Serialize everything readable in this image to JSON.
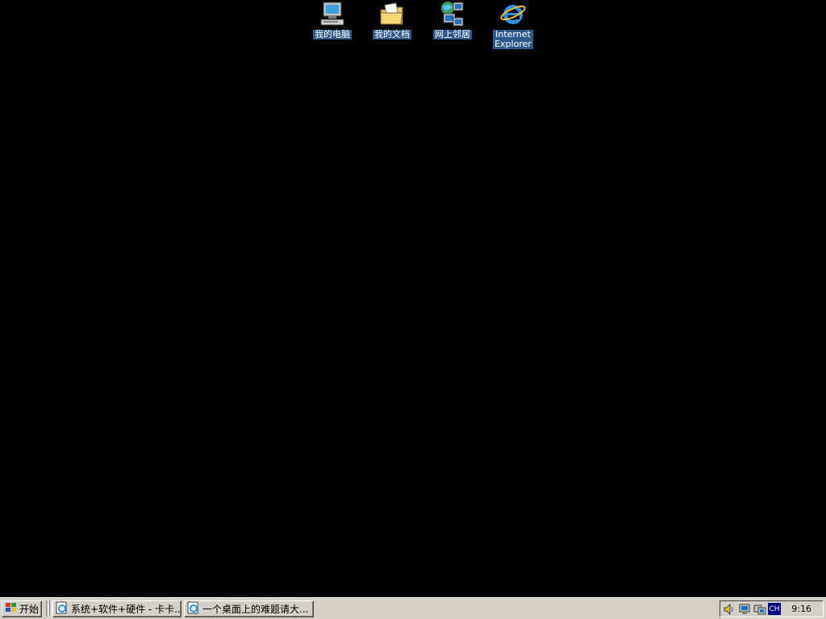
{
  "desktop": {
    "icons": [
      {
        "label": "我的电脑",
        "icon": "my-computer-icon"
      },
      {
        "label": "我的文档",
        "icon": "my-documents-icon"
      },
      {
        "label": "网上邻居",
        "icon": "network-neighborhood-icon"
      },
      {
        "label": "Internet\nExplorer",
        "icon": "internet-explorer-icon"
      }
    ]
  },
  "taskbar": {
    "start_label": "开始",
    "tasks": [
      {
        "label": "系统+软件+硬件 - 卡卡...",
        "icon": "ie-page-icon"
      },
      {
        "label": "一个桌面上的难题请大...",
        "icon": "ie-page-icon"
      }
    ],
    "tray": {
      "icons": [
        "speaker-icon",
        "network-icon",
        "monitor-icon"
      ],
      "lang": "CH",
      "clock": "9:16"
    }
  },
  "colors": {
    "desktop_bg": "#000000",
    "taskbar_bg": "#d4d0c8",
    "icon_label_bg": "#2d5a8a",
    "lang_bg": "#000080"
  }
}
